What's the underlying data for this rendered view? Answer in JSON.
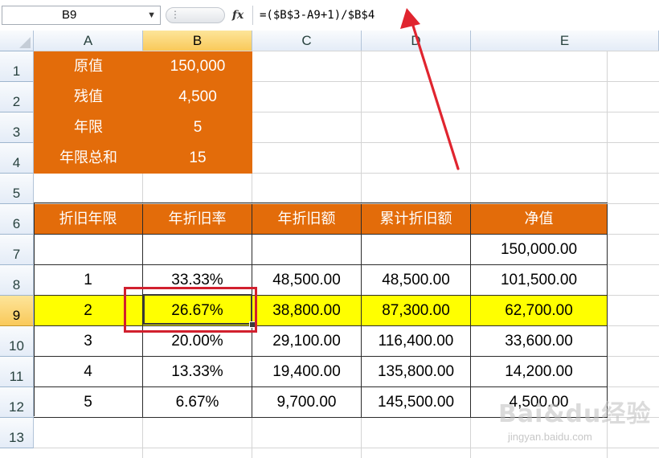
{
  "formula_bar": {
    "name_box": "B9",
    "name_box_arrow": "▼",
    "pill_dots": "⋮",
    "fx_label": "fx",
    "formula": "=($B$3-A9+1)/$B$4"
  },
  "columns": [
    "A",
    "B",
    "C",
    "D",
    "E"
  ],
  "selected_column": "B",
  "rows": [
    "1",
    "2",
    "3",
    "4",
    "5",
    "6",
    "7",
    "8",
    "9",
    "10",
    "11",
    "12",
    "13"
  ],
  "selected_row": "9",
  "params": [
    {
      "label": "原值",
      "value": "150,000"
    },
    {
      "label": "残值",
      "value": "4,500"
    },
    {
      "label": "年限",
      "value": "5"
    },
    {
      "label": "年限总和",
      "value": "15"
    }
  ],
  "table": {
    "headers": [
      "折旧年限",
      "年折旧率",
      "年折旧额",
      "累计折旧额",
      "净值"
    ],
    "rows": [
      [
        "",
        "",
        "",
        "",
        "150,000.00"
      ],
      [
        "1",
        "33.33%",
        "48,500.00",
        "48,500.00",
        "101,500.00"
      ],
      [
        "2",
        "26.67%",
        "38,800.00",
        "87,300.00",
        "62,700.00"
      ],
      [
        "3",
        "20.00%",
        "29,100.00",
        "116,400.00",
        "33,600.00"
      ],
      [
        "4",
        "13.33%",
        "19,400.00",
        "135,800.00",
        "14,200.00"
      ],
      [
        "5",
        "6.67%",
        "9,700.00",
        "145,500.00",
        "4,500.00"
      ]
    ],
    "highlight_row_index": 2
  },
  "colors": {
    "orange": "#e36c0a",
    "highlight_yellow": "#ffff00",
    "annotation_red": "#d1202e"
  },
  "watermark": {
    "brand": "Bai&du经验",
    "url": "jingyan.baidu.com"
  }
}
